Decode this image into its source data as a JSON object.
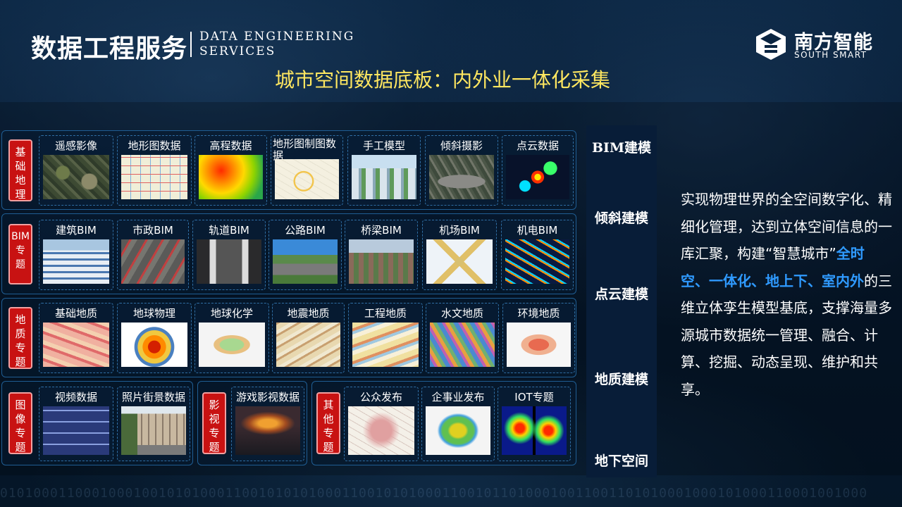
{
  "header": {
    "title_cn": "数据工程服务",
    "title_en": "DATA ENGINEERING\nSERVICES",
    "subtitle": "城市空间数据底板：内外业一体化采集"
  },
  "logo": {
    "name_cn": "南方智能",
    "name_en": "SOUTH SMART"
  },
  "binary_strip": "01010001100010001001010100011001010101000110010101000110010110100010011001101010001000101000110001001000",
  "groups": [
    {
      "tag": "基\n础\n地\n理",
      "items": [
        "遥感影像",
        "地形图数据",
        "高程数据",
        "地形图制图数据",
        "手工模型",
        "倾斜摄影",
        "点云数据"
      ]
    },
    {
      "tag": "BIM\n专\n题",
      "items": [
        "建筑BIM",
        "市政BIM",
        "轨道BIM",
        "公路BIM",
        "桥梁BIM",
        "机场BIM",
        "机电BIM"
      ]
    },
    {
      "tag": "地\n质\n专\n题",
      "items": [
        "基础地质",
        "地球物理",
        "地球化学",
        "地震地质",
        "工程地质",
        "水文地质",
        "环境地质"
      ]
    },
    {
      "tag": "图\n像\n专\n题",
      "items": [
        "视频数据",
        "照片街景数据"
      ]
    },
    {
      "tag": "影\n视\n专\n题",
      "items": [
        "游戏影视数据"
      ]
    },
    {
      "tag": "其\n他\n专\n题",
      "items": [
        "公众发布",
        "企事业发布",
        "IOT专题"
      ]
    }
  ],
  "sidebar": [
    "BIM建模",
    "倾斜建模",
    "点云建模",
    "地质建模",
    "地下空间"
  ],
  "description": {
    "part1": "实现物理世界的全空间数字化、精细化管理，达到立体空间信息的一库汇聚，构建“智慧城市”",
    "highlight": "全时空、一体化、地上下、室内外",
    "part2": "的三维立体孪生模型基底，支撑海量多源城市数据统一管理、融合、计算、挖掘、动态呈现、维护和共享。"
  }
}
